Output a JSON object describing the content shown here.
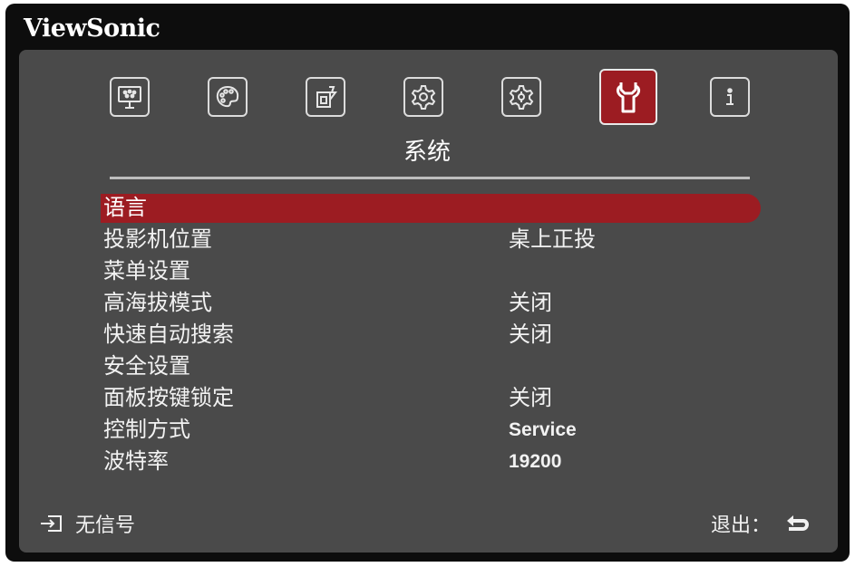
{
  "brand": "ViewSonic",
  "tabs": [
    {
      "id": "display",
      "icon": "display-screen-icon",
      "active": false
    },
    {
      "id": "image",
      "icon": "palette-icon",
      "active": false
    },
    {
      "id": "power",
      "icon": "power-management-icon",
      "active": false
    },
    {
      "id": "basic",
      "icon": "basic-settings-gear-icon",
      "active": false
    },
    {
      "id": "advanced",
      "icon": "advanced-settings-gear-icon",
      "active": false
    },
    {
      "id": "system",
      "icon": "wrench-icon",
      "active": true
    },
    {
      "id": "info",
      "icon": "info-icon",
      "active": false
    }
  ],
  "active_tab_title": "系统",
  "menu": [
    {
      "label": "语言",
      "value": ""
    },
    {
      "label": "投影机位置",
      "value": "桌上正投"
    },
    {
      "label": "菜单设置",
      "value": ""
    },
    {
      "label": "高海拔模式",
      "value": "关闭"
    },
    {
      "label": "快速自动搜索",
      "value": "关闭"
    },
    {
      "label": "安全设置",
      "value": ""
    },
    {
      "label": "面板按键锁定",
      "value": "关闭"
    },
    {
      "label": "控制方式",
      "value": "Service"
    },
    {
      "label": "波特率",
      "value": "19200"
    }
  ],
  "selected_index": 0,
  "footer": {
    "input_status": "无信号",
    "exit_label": "退出："
  },
  "colors": {
    "accent": "#9c1c22",
    "panel": "#4a4a4a",
    "frame": "#0d0d0d",
    "text": "#f2f2f2"
  }
}
